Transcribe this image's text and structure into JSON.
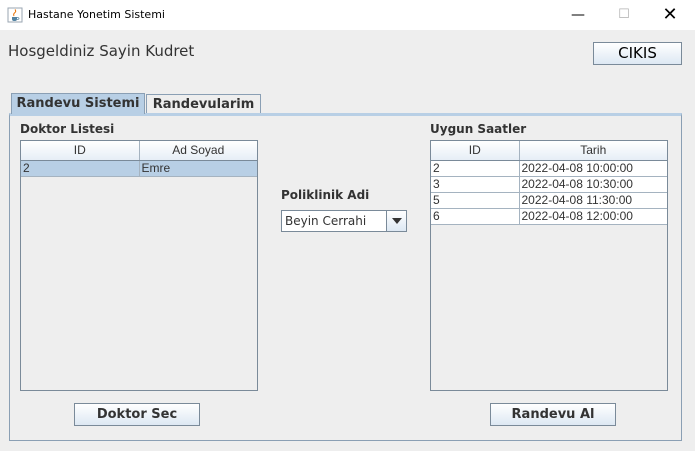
{
  "window": {
    "title": "Hastane Yonetim Sistemi",
    "icon": "java-cup-icon",
    "controls": {
      "minimize": "—",
      "maximize": "☐",
      "close": "✕"
    }
  },
  "header": {
    "welcome_text": "Hosgeldiniz Sayin Kudret",
    "logout_label": "CIKIS"
  },
  "tabs": [
    {
      "label": "Randevu Sistemi",
      "active": true
    },
    {
      "label": "Randevularim",
      "active": false
    }
  ],
  "doctor_list": {
    "title": "Doktor Listesi",
    "columns": [
      "ID",
      "Ad Soyad"
    ],
    "rows": [
      {
        "id": "2",
        "name": "Emre",
        "selected": true
      }
    ],
    "button_label": "Doktor Sec"
  },
  "clinic": {
    "label": "Poliklinik Adi",
    "selected": "Beyin Cerrahi"
  },
  "available_times": {
    "title": "Uygun Saatler",
    "columns": [
      "ID",
      "Tarih"
    ],
    "rows": [
      {
        "id": "2",
        "date": "2022-04-08 10:00:00"
      },
      {
        "id": "3",
        "date": "2022-04-08 10:30:00"
      },
      {
        "id": "5",
        "date": "2022-04-08 11:30:00"
      },
      {
        "id": "6",
        "date": "2022-04-08 12:00:00"
      }
    ],
    "button_label": "Randevu Al"
  },
  "colors": {
    "selection": "#b8cfe5",
    "background": "#eeeeee",
    "border": "#7a8a99"
  }
}
